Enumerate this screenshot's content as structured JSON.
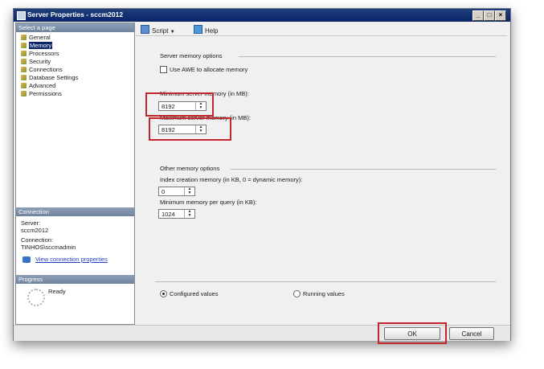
{
  "window": {
    "title": "Server Properties - sccm2012"
  },
  "left_pane": {
    "select_page_header": "Select a page",
    "pages": [
      {
        "label": "General",
        "selected": false
      },
      {
        "label": "Memory",
        "selected": true
      },
      {
        "label": "Processors",
        "selected": false
      },
      {
        "label": "Security",
        "selected": false
      },
      {
        "label": "Connections",
        "selected": false
      },
      {
        "label": "Database Settings",
        "selected": false
      },
      {
        "label": "Advanced",
        "selected": false
      },
      {
        "label": "Permissions",
        "selected": false
      }
    ],
    "connection_header": "Connection",
    "server_label": "Server:",
    "server_value": "sccm2012",
    "connection_label": "Connection:",
    "connection_value": "TINHOS\\sccmadmin",
    "view_connection_link": "View connection properties",
    "progress_header": "Progress",
    "progress_status": "Ready"
  },
  "toolbar": {
    "script_label": "Script",
    "script_arrow": "▼",
    "help_label": "Help"
  },
  "memory": {
    "server_memory_options_title": "Server memory options",
    "use_awe_label": "Use AWE to allocate memory",
    "use_awe_checked": false,
    "min_server_memory_label": "Minimum server memory (in MB):",
    "min_server_memory_value": "8192",
    "max_server_memory_label": "Maximum server memory (in MB):",
    "max_server_memory_value": "8192",
    "other_memory_options_title": "Other memory options",
    "index_creation_label": "Index creation memory (in KB, 0 = dynamic memory):",
    "index_creation_value": "0",
    "min_query_label": "Minimum memory per query (in KB):",
    "min_query_value": "1024",
    "configured_values_label": "Configured values",
    "running_values_label": "Running values",
    "selected_values": "configured"
  },
  "buttons": {
    "ok": "OK",
    "cancel": "Cancel"
  },
  "colors": {
    "highlight_box": "#c0262c",
    "title_bar": "#0a246a",
    "selection": "#0a246a"
  }
}
